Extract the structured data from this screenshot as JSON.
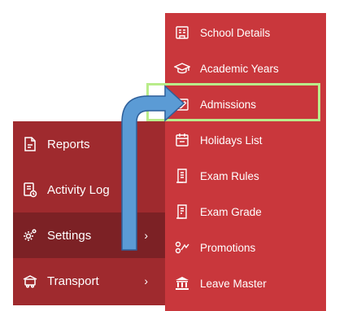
{
  "left_menu": {
    "items": [
      {
        "label": "Reports",
        "icon": "report-icon"
      },
      {
        "label": "Activity Log",
        "icon": "activity-log-icon"
      },
      {
        "label": "Settings",
        "icon": "settings-icon",
        "active": true,
        "chevron": "›"
      },
      {
        "label": "Transport",
        "icon": "transport-icon",
        "chevron": "›"
      }
    ]
  },
  "settings_submenu": {
    "items": [
      {
        "label": "School Details",
        "icon": "school-details-icon"
      },
      {
        "label": "Academic Years",
        "icon": "graduation-cap-icon"
      },
      {
        "label": "Admissions",
        "icon": "admissions-icon",
        "highlighted": true
      },
      {
        "label": "Holidays List",
        "icon": "calendar-icon"
      },
      {
        "label": "Exam Rules",
        "icon": "exam-rules-icon"
      },
      {
        "label": "Exam Grade",
        "icon": "exam-grade-icon"
      },
      {
        "label": "Promotions",
        "icon": "promotions-icon"
      },
      {
        "label": "Leave Master",
        "icon": "bank-icon"
      }
    ]
  },
  "annotation": {
    "highlight_color": "#b9ec8a",
    "arrow_color": "#5b9bd5"
  },
  "colors": {
    "left_menu_bg": "#9f2a2e",
    "left_menu_active_bg": "#7c2125",
    "submenu_bg": "#c9373c",
    "text": "#ffffff"
  }
}
